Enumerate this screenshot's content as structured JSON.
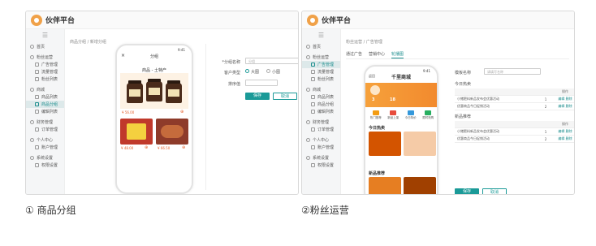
{
  "brand": "伙伴平台",
  "colors": {
    "accent": "#1b9a98",
    "brand_orange": "#f0a148",
    "price": "#e5602c"
  },
  "screen1": {
    "breadcrumb": "商品分组 / 新增分组",
    "sidebar": [
      {
        "type": "group",
        "label": "首页"
      },
      {
        "type": "group",
        "label": "粉丝运营"
      },
      {
        "type": "child",
        "label": "广告管理"
      },
      {
        "type": "child",
        "label": "流量管理"
      },
      {
        "type": "child",
        "label": "粉丝列表"
      },
      {
        "type": "group",
        "label": "商城"
      },
      {
        "type": "child",
        "label": "商品列表"
      },
      {
        "type": "child",
        "label": "商品分组",
        "active": true
      },
      {
        "type": "child",
        "label": "编辑列表"
      },
      {
        "type": "group",
        "label": "财务管理"
      },
      {
        "type": "child",
        "label": "订单管理"
      },
      {
        "type": "group",
        "label": "个人中心"
      },
      {
        "type": "child",
        "label": "账户管理"
      },
      {
        "type": "group",
        "label": "系统设置"
      },
      {
        "type": "child",
        "label": "权限设置"
      }
    ],
    "phone": {
      "status": "9:41",
      "back": "×",
      "title": "分组",
      "heading": "商品 - 土特产",
      "products": [
        {
          "price": "¥ 56.00"
        },
        {
          "price": "¥ 48.00"
        },
        {
          "price": "¥ 66.50"
        }
      ]
    },
    "form": {
      "name_label": "*分组名称",
      "name_placeholder": "分组",
      "type_label": "客户类型",
      "opt1": "大图",
      "opt2": "小图",
      "sort_label": "排序值",
      "save": "保存",
      "cancel": "取消"
    }
  },
  "screen2": {
    "breadcrumb": "粉丝运营 / 广告管理",
    "tabs": [
      "通过广告",
      "营销中心",
      "轮播图"
    ],
    "sidebar": [
      {
        "type": "group",
        "label": "首页"
      },
      {
        "type": "group",
        "label": "粉丝运营"
      },
      {
        "type": "child",
        "label": "广告管理",
        "active": true
      },
      {
        "type": "child",
        "label": "流量管理"
      },
      {
        "type": "child",
        "label": "粉丝列表"
      },
      {
        "type": "group",
        "label": "商城"
      },
      {
        "type": "child",
        "label": "商品列表"
      },
      {
        "type": "child",
        "label": "商品分组"
      },
      {
        "type": "child",
        "label": "编辑列表"
      },
      {
        "type": "group",
        "label": "财务管理"
      },
      {
        "type": "child",
        "label": "订单管理"
      },
      {
        "type": "group",
        "label": "个人中心"
      },
      {
        "type": "child",
        "label": "账户管理"
      },
      {
        "type": "group",
        "label": "系统设置"
      },
      {
        "type": "child",
        "label": "权限设置"
      }
    ],
    "phone": {
      "status": "9:41",
      "title": "千里商城",
      "left": "返回",
      "stats": [
        "3",
        "18"
      ],
      "menu": [
        "热门推荐",
        "新品上架",
        "今日特价",
        "限时抢购"
      ],
      "section": "今日热卖",
      "section2": "新品推荐"
    },
    "form": {
      "name_label": "模板名称",
      "name_placeholder": "请填写名称",
      "section1": "今日热卖",
      "section2": "新品推荐",
      "col_op": "操作",
      "edit": "编辑",
      "del": "删除",
      "rows1": [
        {
          "name": "小猪肥料新品发布会优惠活动",
          "n": "1"
        },
        {
          "name": "优惠商品今日促销活动",
          "n": "2"
        }
      ],
      "rows2": [
        {
          "name": "小猪肥料新品发布会优惠活动",
          "n": "1"
        },
        {
          "name": "优惠商品今日促销活动",
          "n": "2"
        }
      ],
      "save": "保存",
      "cancel": "取消"
    }
  },
  "captions": [
    "① 商品分组",
    "②粉丝运营"
  ]
}
